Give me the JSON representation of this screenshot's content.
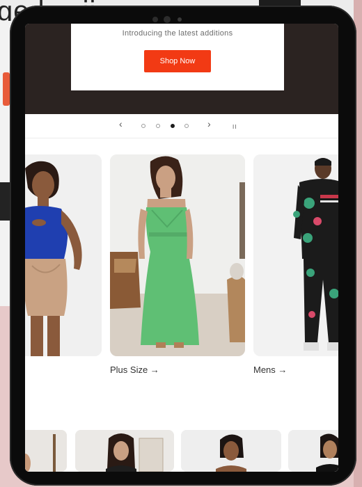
{
  "background": {
    "partial_heading": "ge  l    w   ii  "
  },
  "hero": {
    "subtitle": "Introducing the latest additions",
    "cta_label": "Shop Now"
  },
  "carousel": {
    "prev_label": "‹",
    "next_label": "›",
    "pause_label": "II",
    "slide_count": 4,
    "active_slide": 3
  },
  "categories": [
    {
      "label": "",
      "image": "woman-blue-top-tan-skirt"
    },
    {
      "label": "Plus Size →",
      "image": "woman-green-polka-dot-dress"
    },
    {
      "label": "Mens →",
      "image": "man-floral-tracksuit"
    }
  ],
  "bottom_row": [
    {
      "image": "partial-model"
    },
    {
      "image": "woman-dark-hair"
    },
    {
      "image": "woman-ponytail"
    },
    {
      "image": "woman-black-top"
    }
  ],
  "colors": {
    "accent": "#f23a14",
    "hero_bg": "#2b2321",
    "page_bg": "#e7c9c9"
  }
}
